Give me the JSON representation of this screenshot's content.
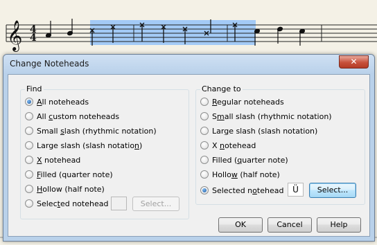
{
  "dialog": {
    "title": "Change Noteheads",
    "close_glyph": "✕"
  },
  "find": {
    "label": "Find",
    "options": [
      {
        "pre": "",
        "u": "A",
        "post": "ll noteheads",
        "checked": true
      },
      {
        "pre": "All ",
        "u": "c",
        "post": "ustom noteheads",
        "checked": false
      },
      {
        "pre": "Small ",
        "u": "s",
        "post": "lash (rhythmic notation)",
        "checked": false
      },
      {
        "pre": "Large slash (slash notatio",
        "u": "n",
        "post": ")",
        "checked": false
      },
      {
        "pre": "",
        "u": "X",
        "post": " notehead",
        "checked": false
      },
      {
        "pre": "",
        "u": "F",
        "post": "illed (quarter note)",
        "checked": false
      },
      {
        "pre": "",
        "u": "H",
        "post": "ollow (half note)",
        "checked": false
      },
      {
        "pre": "Selec",
        "u": "t",
        "post": "ed notehead",
        "checked": false
      }
    ],
    "select_button": "Select...",
    "preview_glyph": ""
  },
  "change_to": {
    "label": "Change to",
    "options": [
      {
        "pre": "",
        "u": "R",
        "post": "egular noteheads",
        "checked": false
      },
      {
        "pre": "S",
        "u": "m",
        "post": "all slash (rhythmic notation)",
        "checked": false
      },
      {
        "pre": "Lar",
        "u": "g",
        "post": "e slash (slash notation)",
        "checked": false
      },
      {
        "pre": "X ",
        "u": "n",
        "post": "otehead",
        "checked": false
      },
      {
        "pre": "Filled (",
        "u": "q",
        "post": "uarter note)",
        "checked": false
      },
      {
        "pre": "Hollo",
        "u": "w",
        "post": " (half note)",
        "checked": false
      },
      {
        "pre": "Selected n",
        "u": "o",
        "post": "tehead",
        "checked": true
      }
    ],
    "select_button": "Select...",
    "preview_glyph": "Ü"
  },
  "buttons": {
    "ok": "OK",
    "cancel": "Cancel",
    "help": "Help"
  },
  "score": {
    "time_sig_top": "4",
    "time_sig_bottom": "4",
    "selection_color": "#9ec7f7"
  }
}
